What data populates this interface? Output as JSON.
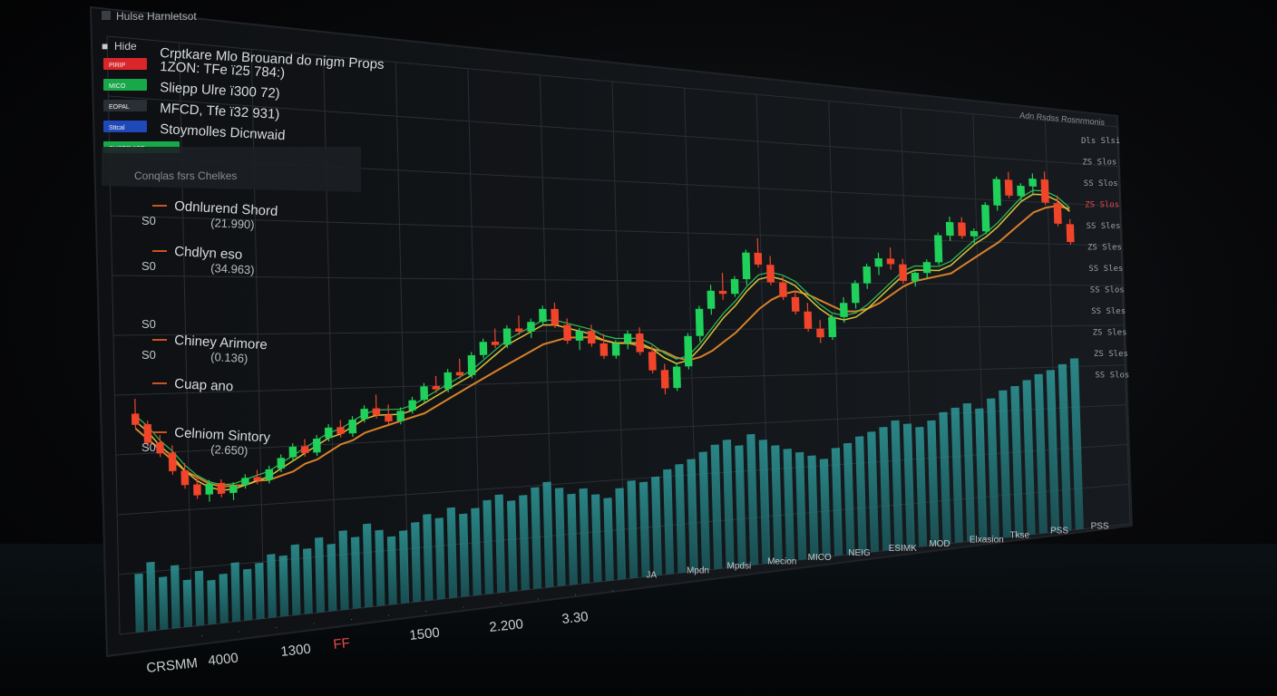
{
  "window_title": "Hulse Harnletsot",
  "menu": {
    "mode_label": "Hide",
    "chart_title": "Crptkare Mlo Brouand do nigm Props"
  },
  "watchlist": [
    {
      "tag": "PIRIP",
      "tag_color": "#d8262a",
      "text": "1ZON: TFe ï25 784:)"
    },
    {
      "tag": "MICO",
      "tag_color": "#17a84a",
      "text": "Sliepp Ulre ï300 72)"
    },
    {
      "tag": "EOPAL",
      "tag_color": "#2a2f36",
      "text": "MFCD, Tfe ï32 931)"
    },
    {
      "tag": "Sttcal",
      "tag_color": "#1f48b8",
      "text": "Stoymolles Dicnwaid"
    },
    {
      "tag": "SHSTSVICE",
      "tag_color": "#17a84a",
      "text": ""
    }
  ],
  "dropdown_label": "Conqlas fsrs Chelkes",
  "indicators": [
    {
      "name": "Odnlurend Shord",
      "value": "(21.990)",
      "swatch": "#c8561e",
      "level": "S0"
    },
    {
      "name": "Chdlyn eso",
      "value": "(34.963)",
      "swatch": "#c8561e",
      "level": "S0"
    },
    {
      "name": "",
      "value": "",
      "swatch": "",
      "level": "S0"
    },
    {
      "name": "Chiney Arimore",
      "value": "(0.136)",
      "swatch": "#c8561e",
      "level": "S0"
    },
    {
      "name": "Cuap ano",
      "value": "",
      "swatch": "#c8561e",
      "level": ""
    },
    {
      "name": "Celniom Sintory",
      "value": "(2.650)",
      "swatch": "#c8561e",
      "level": "S0"
    }
  ],
  "right_header": "Adn Rsdss Rosnrmonis",
  "right_scale": [
    {
      "text": "Dls Slsi",
      "color": "#9aa0a6"
    },
    {
      "text": "ZS Slos",
      "color": "#9aa0a6"
    },
    {
      "text": "SS Slos",
      "color": "#9aa0a6"
    },
    {
      "text": "ZS Slos",
      "color": "#e8484a"
    },
    {
      "text": "SS Sles",
      "color": "#9aa0a6"
    },
    {
      "text": "ZS Sles",
      "color": "#9aa0a6"
    },
    {
      "text": "SS Sles",
      "color": "#9aa0a6"
    },
    {
      "text": "SS Slos",
      "color": "#9aa0a6"
    },
    {
      "text": "SS Sles",
      "color": "#9aa0a6"
    },
    {
      "text": "ZS Sles",
      "color": "#9aa0a6"
    },
    {
      "text": "ZS Sles",
      "color": "#9aa0a6"
    },
    {
      "text": "SS Slos",
      "color": "#9aa0a6"
    }
  ],
  "x_axis_labels": [
    "JA",
    "Mpdn",
    "Mpdsi",
    "Mecion",
    "MICO",
    "NEIG",
    "ESIMK",
    "MOD",
    "Elxasion",
    "Tkse",
    "PSS",
    "PSS"
  ],
  "bottom_labels": [
    "CRSMM",
    "4000",
    "1300",
    "FF",
    "1500",
    "2.200",
    "3.30"
  ],
  "colors": {
    "up": "#1fd15a",
    "down": "#f0452a",
    "ma_fast": "#d9c23a",
    "ma_slow": "#d8812a",
    "ma_green": "#2fbf5a",
    "volume": "#2a8c8c",
    "grid": "#2a2f35",
    "panel_bg": "#121518"
  },
  "chart_data": {
    "type": "candlestick",
    "title": "Crptkare Mlo Brouand do nigm Props",
    "candles": [
      {
        "o": 40,
        "h": 44,
        "l": 36,
        "c": 37
      },
      {
        "o": 37,
        "h": 38,
        "l": 31,
        "c": 32
      },
      {
        "o": 32,
        "h": 34,
        "l": 28,
        "c": 29
      },
      {
        "o": 29,
        "h": 31,
        "l": 23,
        "c": 24
      },
      {
        "o": 24,
        "h": 26,
        "l": 19,
        "c": 20
      },
      {
        "o": 20,
        "h": 22,
        "l": 16,
        "c": 17
      },
      {
        "o": 17,
        "h": 21,
        "l": 15,
        "c": 20
      },
      {
        "o": 20,
        "h": 21,
        "l": 16,
        "c": 17
      },
      {
        "o": 17,
        "h": 20,
        "l": 15,
        "c": 19
      },
      {
        "o": 19,
        "h": 22,
        "l": 18,
        "c": 21
      },
      {
        "o": 21,
        "h": 23,
        "l": 19,
        "c": 20
      },
      {
        "o": 20,
        "h": 24,
        "l": 19,
        "c": 23
      },
      {
        "o": 23,
        "h": 27,
        "l": 22,
        "c": 26
      },
      {
        "o": 26,
        "h": 30,
        "l": 25,
        "c": 29
      },
      {
        "o": 29,
        "h": 31,
        "l": 26,
        "c": 27
      },
      {
        "o": 27,
        "h": 32,
        "l": 26,
        "c": 31
      },
      {
        "o": 31,
        "h": 35,
        "l": 30,
        "c": 34
      },
      {
        "o": 34,
        "h": 36,
        "l": 31,
        "c": 32
      },
      {
        "o": 32,
        "h": 37,
        "l": 31,
        "c": 36
      },
      {
        "o": 36,
        "h": 40,
        "l": 35,
        "c": 39
      },
      {
        "o": 39,
        "h": 43,
        "l": 36,
        "c": 37
      },
      {
        "o": 37,
        "h": 40,
        "l": 34,
        "c": 35
      },
      {
        "o": 35,
        "h": 39,
        "l": 34,
        "c": 38
      },
      {
        "o": 38,
        "h": 42,
        "l": 37,
        "c": 41
      },
      {
        "o": 41,
        "h": 46,
        "l": 40,
        "c": 45
      },
      {
        "o": 45,
        "h": 48,
        "l": 43,
        "c": 44
      },
      {
        "o": 44,
        "h": 50,
        "l": 43,
        "c": 49
      },
      {
        "o": 49,
        "h": 53,
        "l": 47,
        "c": 48
      },
      {
        "o": 48,
        "h": 55,
        "l": 47,
        "c": 54
      },
      {
        "o": 54,
        "h": 59,
        "l": 53,
        "c": 58
      },
      {
        "o": 58,
        "h": 62,
        "l": 56,
        "c": 57
      },
      {
        "o": 57,
        "h": 63,
        "l": 56,
        "c": 62
      },
      {
        "o": 62,
        "h": 66,
        "l": 60,
        "c": 61
      },
      {
        "o": 61,
        "h": 65,
        "l": 59,
        "c": 64
      },
      {
        "o": 64,
        "h": 69,
        "l": 63,
        "c": 68
      },
      {
        "o": 68,
        "h": 70,
        "l": 62,
        "c": 63
      },
      {
        "o": 63,
        "h": 65,
        "l": 57,
        "c": 58
      },
      {
        "o": 58,
        "h": 62,
        "l": 55,
        "c": 61
      },
      {
        "o": 61,
        "h": 63,
        "l": 56,
        "c": 57
      },
      {
        "o": 57,
        "h": 60,
        "l": 52,
        "c": 53
      },
      {
        "o": 53,
        "h": 58,
        "l": 52,
        "c": 57
      },
      {
        "o": 57,
        "h": 61,
        "l": 55,
        "c": 60
      },
      {
        "o": 60,
        "h": 62,
        "l": 53,
        "c": 54
      },
      {
        "o": 54,
        "h": 56,
        "l": 47,
        "c": 48
      },
      {
        "o": 48,
        "h": 50,
        "l": 40,
        "c": 42
      },
      {
        "o": 42,
        "h": 50,
        "l": 41,
        "c": 49
      },
      {
        "o": 49,
        "h": 60,
        "l": 48,
        "c": 59
      },
      {
        "o": 59,
        "h": 69,
        "l": 57,
        "c": 68
      },
      {
        "o": 68,
        "h": 76,
        "l": 66,
        "c": 74
      },
      {
        "o": 74,
        "h": 80,
        "l": 71,
        "c": 73
      },
      {
        "o": 73,
        "h": 79,
        "l": 72,
        "c": 78
      },
      {
        "o": 78,
        "h": 88,
        "l": 76,
        "c": 87
      },
      {
        "o": 87,
        "h": 92,
        "l": 82,
        "c": 83
      },
      {
        "o": 83,
        "h": 86,
        "l": 76,
        "c": 77
      },
      {
        "o": 77,
        "h": 79,
        "l": 71,
        "c": 72
      },
      {
        "o": 72,
        "h": 74,
        "l": 66,
        "c": 67
      },
      {
        "o": 67,
        "h": 70,
        "l": 60,
        "c": 61
      },
      {
        "o": 61,
        "h": 64,
        "l": 56,
        "c": 58
      },
      {
        "o": 58,
        "h": 66,
        "l": 57,
        "c": 65
      },
      {
        "o": 65,
        "h": 72,
        "l": 63,
        "c": 70
      },
      {
        "o": 70,
        "h": 78,
        "l": 68,
        "c": 77
      },
      {
        "o": 77,
        "h": 84,
        "l": 75,
        "c": 83
      },
      {
        "o": 83,
        "h": 88,
        "l": 80,
        "c": 86
      },
      {
        "o": 86,
        "h": 90,
        "l": 82,
        "c": 84
      },
      {
        "o": 84,
        "h": 86,
        "l": 77,
        "c": 78
      },
      {
        "o": 78,
        "h": 82,
        "l": 76,
        "c": 81
      },
      {
        "o": 81,
        "h": 86,
        "l": 79,
        "c": 85
      },
      {
        "o": 85,
        "h": 96,
        "l": 84,
        "c": 95
      },
      {
        "o": 95,
        "h": 102,
        "l": 93,
        "c": 100
      },
      {
        "o": 100,
        "h": 102,
        "l": 94,
        "c": 95
      },
      {
        "o": 95,
        "h": 98,
        "l": 92,
        "c": 97
      },
      {
        "o": 97,
        "h": 108,
        "l": 96,
        "c": 107
      },
      {
        "o": 107,
        "h": 118,
        "l": 105,
        "c": 117
      },
      {
        "o": 117,
        "h": 120,
        "l": 110,
        "c": 111
      },
      {
        "o": 111,
        "h": 116,
        "l": 109,
        "c": 115
      },
      {
        "o": 115,
        "h": 120,
        "l": 112,
        "c": 118
      },
      {
        "o": 118,
        "h": 121,
        "l": 108,
        "c": 109
      },
      {
        "o": 109,
        "h": 112,
        "l": 100,
        "c": 101
      },
      {
        "o": 101,
        "h": 103,
        "l": 93,
        "c": 94
      }
    ],
    "volume": [
      22,
      26,
      20,
      24,
      18,
      21,
      17,
      19,
      23,
      20,
      22,
      25,
      24,
      28,
      26,
      30,
      27,
      32,
      29,
      34,
      31,
      28,
      30,
      33,
      36,
      34,
      38,
      35,
      37,
      40,
      42,
      39,
      41,
      44,
      46,
      43,
      40,
      42,
      39,
      37,
      41,
      44,
      43,
      45,
      48,
      50,
      52,
      55,
      58,
      60,
      57,
      62,
      59,
      56,
      54,
      52,
      50,
      48,
      53,
      55,
      58,
      60,
      62,
      65,
      63,
      61,
      64,
      68,
      70,
      72,
      69,
      74,
      78,
      80,
      83,
      86,
      88,
      91,
      94
    ],
    "ma_fast": [
      38,
      35,
      31,
      28,
      24,
      21,
      19,
      18,
      18,
      19,
      20,
      21,
      23,
      25,
      27,
      29,
      31,
      32,
      34,
      36,
      37,
      37,
      37,
      38,
      40,
      42,
      44,
      46,
      48,
      51,
      54,
      57,
      59,
      61,
      63,
      63,
      62,
      61,
      60,
      58,
      57,
      57,
      57,
      55,
      52,
      50,
      51,
      55,
      60,
      65,
      69,
      74,
      78,
      79,
      78,
      76,
      72,
      68,
      65,
      64,
      65,
      68,
      72,
      76,
      80,
      82,
      82,
      82,
      84,
      88,
      92,
      95,
      99,
      104,
      109,
      112,
      112,
      110,
      106
    ],
    "ma_slow": [
      36,
      33,
      30,
      27,
      24,
      22,
      20,
      19,
      19,
      19,
      20,
      20,
      21,
      22,
      24,
      25,
      27,
      29,
      30,
      32,
      33,
      34,
      35,
      36,
      37,
      39,
      41,
      43,
      45,
      47,
      49,
      51,
      53,
      55,
      57,
      58,
      59,
      59,
      59,
      58,
      57,
      57,
      56,
      55,
      54,
      52,
      51,
      52,
      54,
      57,
      60,
      64,
      68,
      71,
      73,
      74,
      73,
      71,
      69,
      67,
      67,
      68,
      70,
      73,
      76,
      78,
      79,
      80,
      81,
      84,
      87,
      90,
      93,
      97,
      101,
      105,
      107,
      108,
      107
    ],
    "ylim": [
      10,
      125
    ]
  }
}
